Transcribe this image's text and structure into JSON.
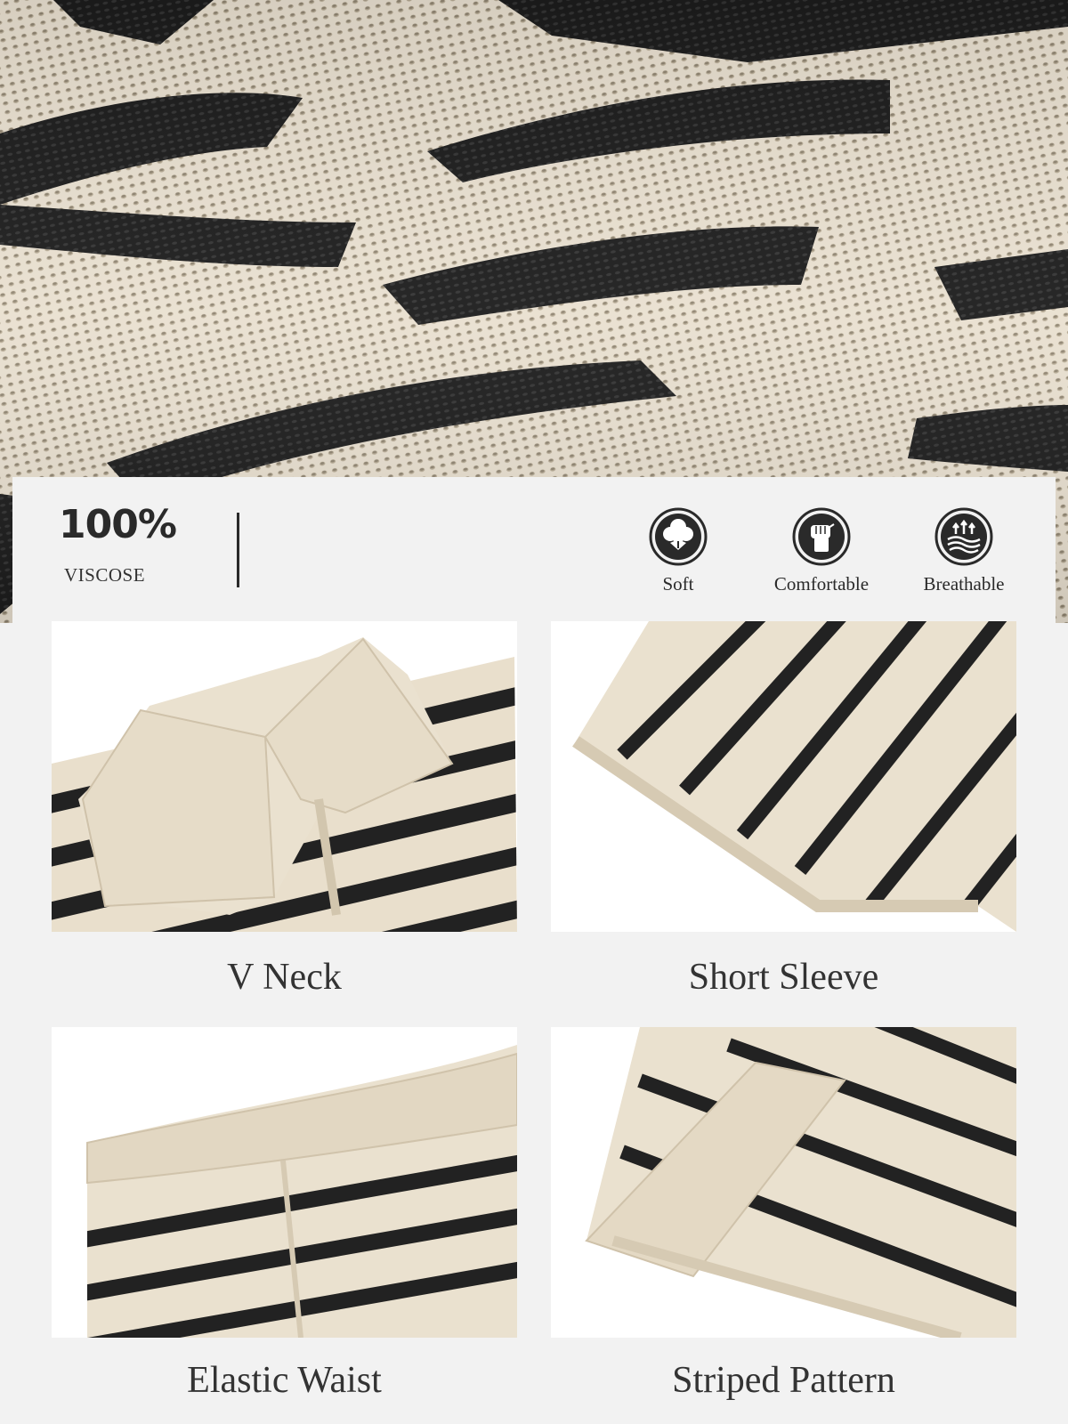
{
  "fabric": {
    "percentage": "100%",
    "material": "VISCOSE"
  },
  "features": [
    {
      "label": "Soft",
      "icon": "cotton-flower-icon"
    },
    {
      "label": "Comfortable",
      "icon": "fist-icon"
    },
    {
      "label": "Breathable",
      "icon": "airflow-icon"
    }
  ],
  "details": [
    {
      "caption": "V Neck"
    },
    {
      "caption": "Short Sleeve"
    },
    {
      "caption": "Elastic Waist"
    },
    {
      "caption": "Striped Pattern"
    }
  ],
  "colors": {
    "cream": "#e8dfcf",
    "stripe": "#1f1f1f",
    "background": "#f2f2f2",
    "text": "#2a2a2a"
  }
}
